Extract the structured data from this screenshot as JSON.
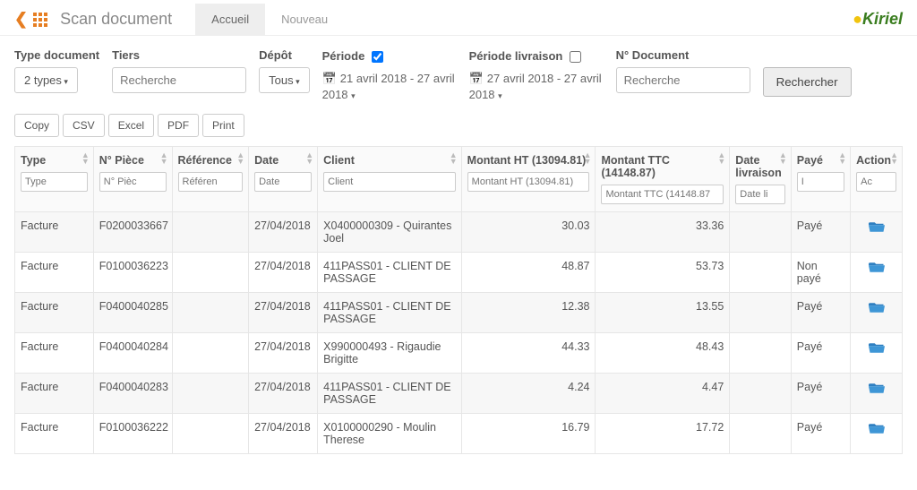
{
  "header": {
    "title": "Scan document",
    "tabs": [
      {
        "label": "Accueil",
        "active": true
      },
      {
        "label": "Nouveau",
        "active": false
      }
    ],
    "logo_text": "Kiriel"
  },
  "filters": {
    "type_doc": {
      "label": "Type document",
      "button": "2 types"
    },
    "tiers": {
      "label": "Tiers",
      "placeholder": "Recherche"
    },
    "depot": {
      "label": "Dépôt",
      "button": "Tous"
    },
    "periode": {
      "label": "Période",
      "checked": true,
      "text": "21 avril 2018 - 27 avril 2018"
    },
    "periode_liv": {
      "label": "Période livraison",
      "checked": false,
      "text": "27 avril 2018 - 27 avril 2018"
    },
    "num_doc": {
      "label": "N° Document",
      "placeholder": "Recherche"
    },
    "search_button": "Rechercher"
  },
  "export_buttons": [
    "Copy",
    "CSV",
    "Excel",
    "PDF",
    "Print"
  ],
  "columns": {
    "type": {
      "label": "Type",
      "placeholder": "Type"
    },
    "piece": {
      "label": "N° Pièce",
      "placeholder": "N° Pièc"
    },
    "ref": {
      "label": "Référence",
      "placeholder": "Référen"
    },
    "date": {
      "label": "Date",
      "placeholder": "Date"
    },
    "client": {
      "label": "Client",
      "placeholder": "Client"
    },
    "ht": {
      "label": "Montant HT (13094.81)",
      "placeholder": "Montant HT (13094.81)"
    },
    "ttc": {
      "label": "Montant TTC (14148.87)",
      "placeholder": "Montant TTC (14148.87"
    },
    "liv": {
      "label": "Date livraison",
      "placeholder": "Date li"
    },
    "paye": {
      "label": "Payé",
      "placeholder": "I"
    },
    "action": {
      "label": "Action",
      "placeholder": "Ac"
    }
  },
  "rows": [
    {
      "type": "Facture",
      "piece": "F0200033667",
      "ref": "",
      "date": "27/04/2018",
      "client": "X0400000309 - Quirantes Joel",
      "ht": "30.03",
      "ttc": "33.36",
      "liv": "",
      "paye": "Payé"
    },
    {
      "type": "Facture",
      "piece": "F0100036223",
      "ref": "",
      "date": "27/04/2018",
      "client": "411PASS01 - CLIENT DE PASSAGE",
      "ht": "48.87",
      "ttc": "53.73",
      "liv": "",
      "paye": "Non payé"
    },
    {
      "type": "Facture",
      "piece": "F0400040285",
      "ref": "",
      "date": "27/04/2018",
      "client": "411PASS01 - CLIENT DE PASSAGE",
      "ht": "12.38",
      "ttc": "13.55",
      "liv": "",
      "paye": "Payé"
    },
    {
      "type": "Facture",
      "piece": "F0400040284",
      "ref": "",
      "date": "27/04/2018",
      "client": "X990000493 - Rigaudie Brigitte",
      "ht": "44.33",
      "ttc": "48.43",
      "liv": "",
      "paye": "Payé"
    },
    {
      "type": "Facture",
      "piece": "F0400040283",
      "ref": "",
      "date": "27/04/2018",
      "client": "411PASS01 - CLIENT DE PASSAGE",
      "ht": "4.24",
      "ttc": "4.47",
      "liv": "",
      "paye": "Payé"
    },
    {
      "type": "Facture",
      "piece": "F0100036222",
      "ref": "",
      "date": "27/04/2018",
      "client": "X0100000290 - Moulin Therese",
      "ht": "16.79",
      "ttc": "17.72",
      "liv": "",
      "paye": "Payé"
    }
  ]
}
